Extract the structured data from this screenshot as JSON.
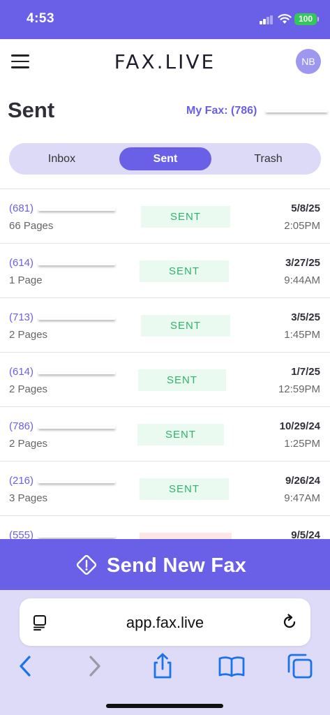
{
  "status_bar": {
    "time": "4:53",
    "battery": "100"
  },
  "header": {
    "logo": "FAX.LIVE",
    "avatar_initials": "NB"
  },
  "page": {
    "title": "Sent",
    "my_fax_label": "My Fax: (786)"
  },
  "tabs": [
    {
      "label": "Inbox",
      "active": false
    },
    {
      "label": "Sent",
      "active": true
    },
    {
      "label": "Trash",
      "active": false
    }
  ],
  "faxes": [
    {
      "number": "(681)",
      "pages": "66 Pages",
      "status": "SENT",
      "date": "5/8/25",
      "time": "2:05PM"
    },
    {
      "number": "(614)",
      "pages": "1 Page",
      "status": "SENT",
      "date": "3/27/25",
      "time": "9:44AM"
    },
    {
      "number": "(713)",
      "pages": "2 Pages",
      "status": "SENT",
      "date": "3/5/25",
      "time": "1:45PM"
    },
    {
      "number": "(614)",
      "pages": "2 Pages",
      "status": "SENT",
      "date": "1/7/25",
      "time": "12:59PM"
    },
    {
      "number": "(786)",
      "pages": "2 Pages",
      "status": "SENT",
      "date": "10/29/24",
      "time": "1:25PM"
    },
    {
      "number": "(216)",
      "pages": "3 Pages",
      "status": "SENT",
      "date": "9/26/24",
      "time": "9:47AM"
    },
    {
      "number": "(555)",
      "pages": "",
      "status": "",
      "date": "9/5/24",
      "time": ""
    }
  ],
  "send_button": {
    "label": "Send New Fax"
  },
  "browser": {
    "url": "app.fax.live"
  },
  "colors": {
    "accent": "#6a60e8",
    "sent_text": "#2eb36a",
    "sent_bg": "#eafaf0",
    "tabs_bg": "#dcdaf7",
    "browser_bg": "#dedbf8",
    "nav_blue": "#1a73e8"
  },
  "icons": [
    "menu-icon",
    "signal-icon",
    "wifi-icon",
    "battery-icon",
    "send-diamond-icon",
    "reader-icon",
    "reload-icon",
    "back-icon",
    "forward-icon",
    "share-icon",
    "bookmarks-icon",
    "tabs-icon"
  ]
}
